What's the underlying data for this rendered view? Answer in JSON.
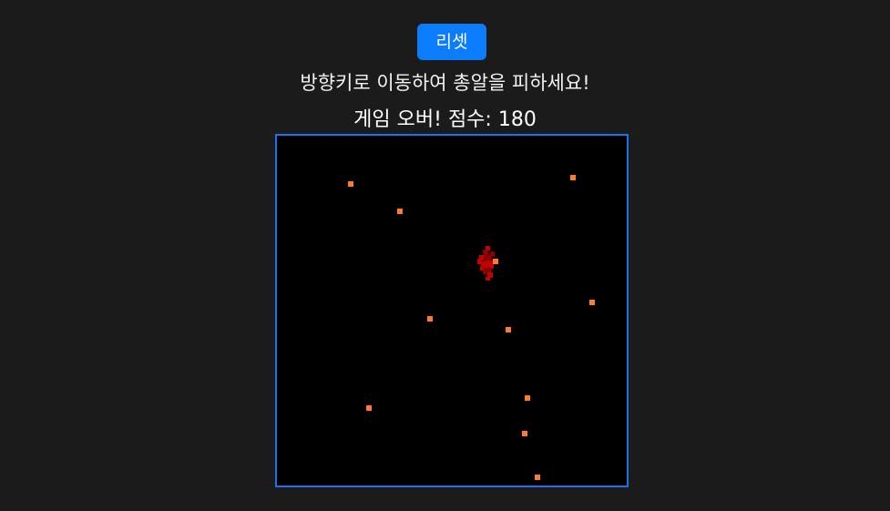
{
  "controls": {
    "reset_label": "리셋"
  },
  "instructions": "방향키로 이동하여 총알을 피하세요!",
  "status": {
    "prefix": "게임 오버! 점수: ",
    "score": "180"
  },
  "colors": {
    "background": "#1b1b1b",
    "button": "#0b7dfa",
    "board_border": "#1a73e8",
    "board_bg": "#000000",
    "bullet": "#ff7a2a",
    "player": "#c40000"
  },
  "game": {
    "state": "game_over",
    "player_icon": "player-explosion-icon",
    "bullet_icon": "bullet-icon",
    "bullet_count": 11
  }
}
